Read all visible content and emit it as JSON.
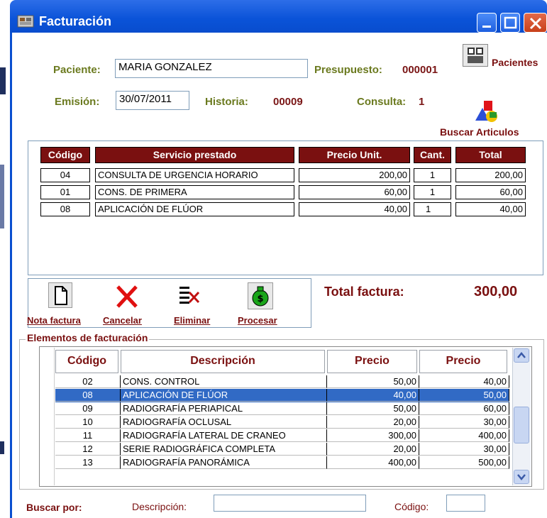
{
  "window": {
    "title": "Facturación"
  },
  "header": {
    "paciente_label": "Paciente:",
    "paciente_value": "MARIA GONZALEZ",
    "presupuesto_label": "Presupuesto:",
    "presupuesto_value": "000001",
    "pacientes_button": "Pacientes",
    "emision_label": "Emisión:",
    "emision_value": "30/07/2011",
    "historia_label": "Historia:",
    "historia_value": "00009",
    "consulta_label": "Consulta:",
    "consulta_value": "1",
    "buscar_articulos": "Buscar Articulos"
  },
  "invoice": {
    "columns": [
      "Código",
      "Servicio prestado",
      "Precio Unit.",
      "Cant.",
      "Total"
    ],
    "rows": [
      [
        "04",
        "CONSULTA DE URGENCIA HORARIO",
        "200,00",
        "1",
        "200,00"
      ],
      [
        "01",
        "CONS.  DE PRIMERA",
        "60,00",
        "1",
        "60,00"
      ],
      [
        "08",
        "APLICACIÓN DE FLÚOR",
        "40,00",
        "1",
        "40,00"
      ]
    ]
  },
  "toolbar": {
    "nota": "Nota factura",
    "cancelar": "Cancelar",
    "eliminar": "Eliminar",
    "procesar": "Procesar"
  },
  "total": {
    "label": "Total factura:",
    "value": "300,00"
  },
  "elements": {
    "legend": "Elementos de facturación",
    "columns": [
      "Código",
      "Descripción",
      "Precio",
      "Precio"
    ],
    "rows": [
      [
        "02",
        "CONS. CONTROL",
        "50,00",
        "40,00"
      ],
      [
        "08",
        "APLICACIÓN DE FLÚOR",
        "40,00",
        "50,00"
      ],
      [
        "09",
        "RADIOGRAFÍA PERIAPICAL",
        "50,00",
        "60,00"
      ],
      [
        "10",
        "RADIOGRAFÍA OCLUSAL",
        "20,00",
        "30,00"
      ],
      [
        "11",
        "RADIOGRAFÍA LATERAL DE CRANEO",
        "300,00",
        "400,00"
      ],
      [
        "12",
        "SERIE RADIOGRÁFICA COMPLETA",
        "20,00",
        "30,00"
      ],
      [
        "13",
        "RADIOGRAFÍA PANORÁMICA",
        "400,00",
        "500,00"
      ]
    ],
    "selected_index": 1
  },
  "search": {
    "label": "Buscar por:",
    "descripcion_label": "Descripción:",
    "descripcion_value": "",
    "codigo_label": "Código:",
    "codigo_value": ""
  },
  "colors": {
    "accent": "#7a1010",
    "label_olive": "#6b7a1f",
    "title_blue": "#0a53d8",
    "selection": "#316ac5"
  }
}
